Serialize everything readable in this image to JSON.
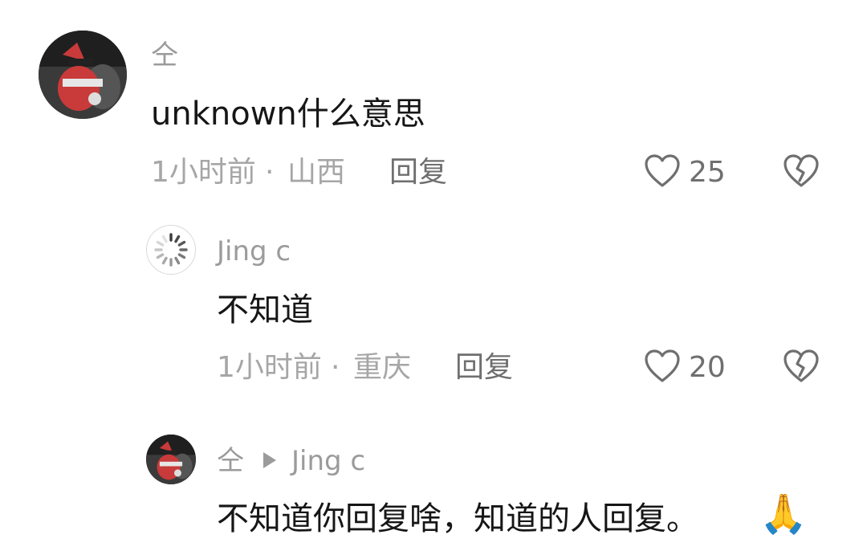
{
  "comments": [
    {
      "username": "仝",
      "text": "unknown什么意思",
      "time": "1小时前",
      "location": "山西",
      "reply_label": "回复",
      "likes": "25"
    },
    {
      "username": "Jing c",
      "text": "不知道",
      "time": "1小时前",
      "location": "重庆",
      "reply_label": "回复",
      "likes": "20"
    },
    {
      "username": "仝",
      "reply_to": "Jing c",
      "text": "不知道你回复啥，知道的人回复。",
      "emoji": "🙏"
    }
  ],
  "icons": {
    "like": "heart-outline-icon",
    "dislike": "broken-heart-icon",
    "reply_arrow": "triangle-right-icon",
    "loading_avatar": "spinner-icon"
  },
  "colors": {
    "primary_text": "#161616",
    "secondary_text": "#9b9b9b",
    "meta_text": "#a6a6a6",
    "action_text": "#6f6f6f"
  },
  "separator": "·"
}
